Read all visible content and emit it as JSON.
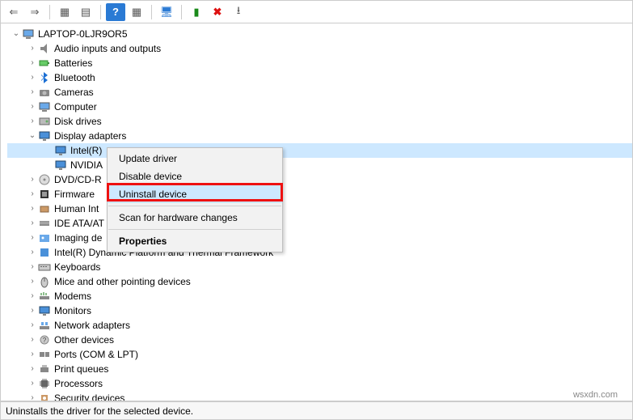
{
  "toolbar": {
    "back": "⇐",
    "forward": "⇒",
    "show_hidden": "▦",
    "properties": "▤",
    "help": "?",
    "scan": "▦",
    "update": "🖥",
    "add_legacy": "▮",
    "remove": "✖",
    "action_down": "⭳"
  },
  "root": {
    "label": "LAPTOP-0LJR9OR5"
  },
  "categories": [
    {
      "label": "Audio inputs and outputs",
      "icon": "audio",
      "chev": "right"
    },
    {
      "label": "Batteries",
      "icon": "battery",
      "chev": "right"
    },
    {
      "label": "Bluetooth",
      "icon": "bluetooth",
      "chev": "right"
    },
    {
      "label": "Cameras",
      "icon": "camera",
      "chev": "right"
    },
    {
      "label": "Computer",
      "icon": "computer",
      "chev": "right"
    },
    {
      "label": "Disk drives",
      "icon": "disk",
      "chev": "right"
    },
    {
      "label": "Display adapters",
      "icon": "display",
      "chev": "down",
      "children": [
        {
          "label": "Intel(R)",
          "icon": "display",
          "selected": true
        },
        {
          "label": "NVIDIA",
          "icon": "display"
        }
      ]
    },
    {
      "label": "DVD/CD-R",
      "icon": "dvd",
      "chev": "right",
      "truncated": true
    },
    {
      "label": "Firmware",
      "icon": "firmware",
      "chev": "right"
    },
    {
      "label": "Human Int",
      "icon": "hid",
      "chev": "right",
      "truncated": true
    },
    {
      "label": "IDE ATA/AT",
      "icon": "ide",
      "chev": "right",
      "truncated": true
    },
    {
      "label": "Imaging de",
      "icon": "imaging",
      "chev": "right",
      "truncated": true
    },
    {
      "label": "Intel(R) Dynamic Platform and Thermal Framework",
      "icon": "intel",
      "chev": "right"
    },
    {
      "label": "Keyboards",
      "icon": "keyboard",
      "chev": "right"
    },
    {
      "label": "Mice and other pointing devices",
      "icon": "mouse",
      "chev": "right"
    },
    {
      "label": "Modems",
      "icon": "modem",
      "chev": "right"
    },
    {
      "label": "Monitors",
      "icon": "monitor",
      "chev": "right"
    },
    {
      "label": "Network adapters",
      "icon": "network",
      "chev": "right"
    },
    {
      "label": "Other devices",
      "icon": "other",
      "chev": "right"
    },
    {
      "label": "Ports (COM & LPT)",
      "icon": "ports",
      "chev": "right"
    },
    {
      "label": "Print queues",
      "icon": "print",
      "chev": "right"
    },
    {
      "label": "Processors",
      "icon": "cpu",
      "chev": "right"
    },
    {
      "label": "Security devices",
      "icon": "security",
      "chev": "right",
      "cutoff": true
    }
  ],
  "context_menu": {
    "items": [
      {
        "label": "Update driver"
      },
      {
        "label": "Disable device"
      },
      {
        "label": "Uninstall device",
        "highlighted": true
      }
    ],
    "scan": {
      "label": "Scan for hardware changes"
    },
    "properties": {
      "label": "Properties"
    }
  },
  "statusbar": {
    "text": "Uninstalls the driver for the selected device."
  },
  "watermark": "wsxdn.com"
}
